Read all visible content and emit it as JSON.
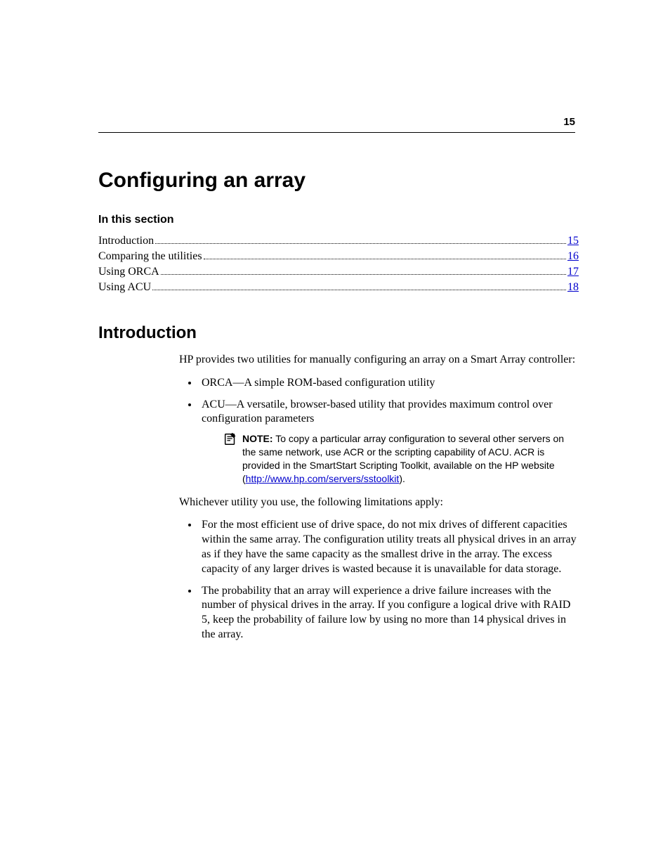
{
  "page_number": "15",
  "title": "Configuring an array",
  "section_label": "In this section",
  "toc": [
    {
      "label": "Introduction",
      "page": "15"
    },
    {
      "label": "Comparing the utilities",
      "page": "16"
    },
    {
      "label": "Using ORCA",
      "page": "17"
    },
    {
      "label": "Using ACU",
      "page": "18"
    }
  ],
  "h2": "Introduction",
  "intro_para": "HP provides two utilities for manually configuring an array on a Smart Array controller:",
  "utilities": [
    "ORCA—A simple ROM-based configuration utility",
    "ACU—A versatile, browser-based utility that provides maximum control over configuration parameters"
  ],
  "note": {
    "label": "NOTE:",
    "text_before_link": "To copy a particular array configuration to several other servers on the same network, use ACR or the scripting capability of ACU. ACR is provided in the SmartStart Scripting Toolkit, available on the HP website (",
    "link_text": "http://www.hp.com/servers/sstoolkit",
    "text_after_link": ")."
  },
  "limitations_intro": "Whichever utility you use, the following limitations apply:",
  "limitations": [
    "For the most efficient use of drive space, do not mix drives of different capacities within the same array. The configuration utility treats all physical drives in an array as if they have the same capacity as the smallest drive in the array. The excess capacity of any larger drives is wasted because it is unavailable for data storage.",
    "The probability that an array will experience a drive failure increases with the number of physical drives in the array. If you configure a logical drive with RAID 5, keep the probability of failure low by using no more than 14 physical drives in the array."
  ]
}
